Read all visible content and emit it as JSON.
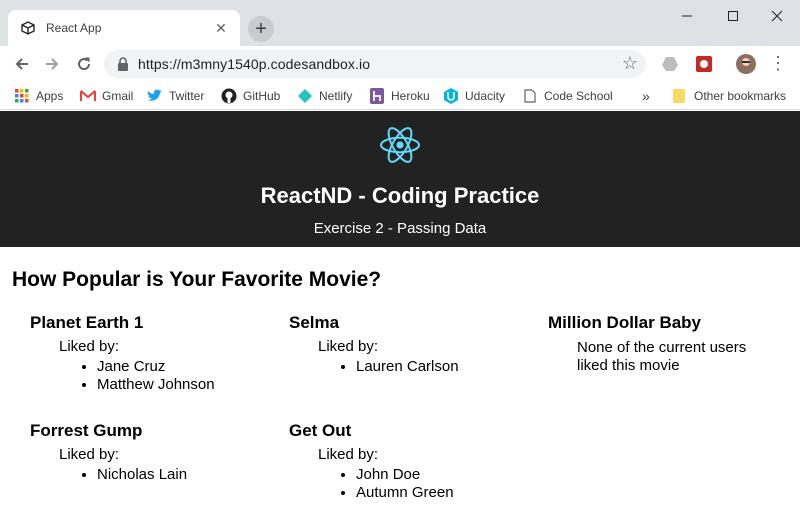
{
  "browser": {
    "tab_title": "React App",
    "url": "https://m3mny1540p.codesandbox.io",
    "bookmarks": [
      {
        "label": "Apps",
        "icon": "apps-grid-icon"
      },
      {
        "label": "Gmail",
        "icon": "gmail-icon"
      },
      {
        "label": "Twitter",
        "icon": "twitter-icon"
      },
      {
        "label": "GitHub",
        "icon": "github-icon"
      },
      {
        "label": "Netlify",
        "icon": "netlify-icon"
      },
      {
        "label": "Heroku",
        "icon": "heroku-icon"
      },
      {
        "label": "Udacity",
        "icon": "udacity-icon"
      },
      {
        "label": "Code School",
        "icon": "page-icon"
      }
    ],
    "overflow": "»",
    "other_bookmarks": "Other bookmarks"
  },
  "header": {
    "title": "ReactND - Coding Practice",
    "subtitle": "Exercise 2 - Passing Data"
  },
  "page": {
    "heading": "How Popular is Your Favorite Movie?",
    "liked_by_label": "Liked by:",
    "movies": [
      {
        "title": "Planet Earth 1",
        "users": [
          "Jane Cruz",
          "Matthew Johnson"
        ]
      },
      {
        "title": "Selma",
        "users": [
          "Lauren Carlson"
        ]
      },
      {
        "title": "Million Dollar Baby",
        "users": [],
        "empty_text": "None of the current users liked this movie"
      },
      {
        "title": "Forrest Gump",
        "users": [
          "Nicholas Lain"
        ]
      },
      {
        "title": "Get Out",
        "users": [
          "John Doe",
          "Autumn Green"
        ]
      }
    ]
  },
  "colors": {
    "header_bg": "#222222",
    "react_blue": "#61dafb",
    "tab_strip": "#dee1e6"
  }
}
